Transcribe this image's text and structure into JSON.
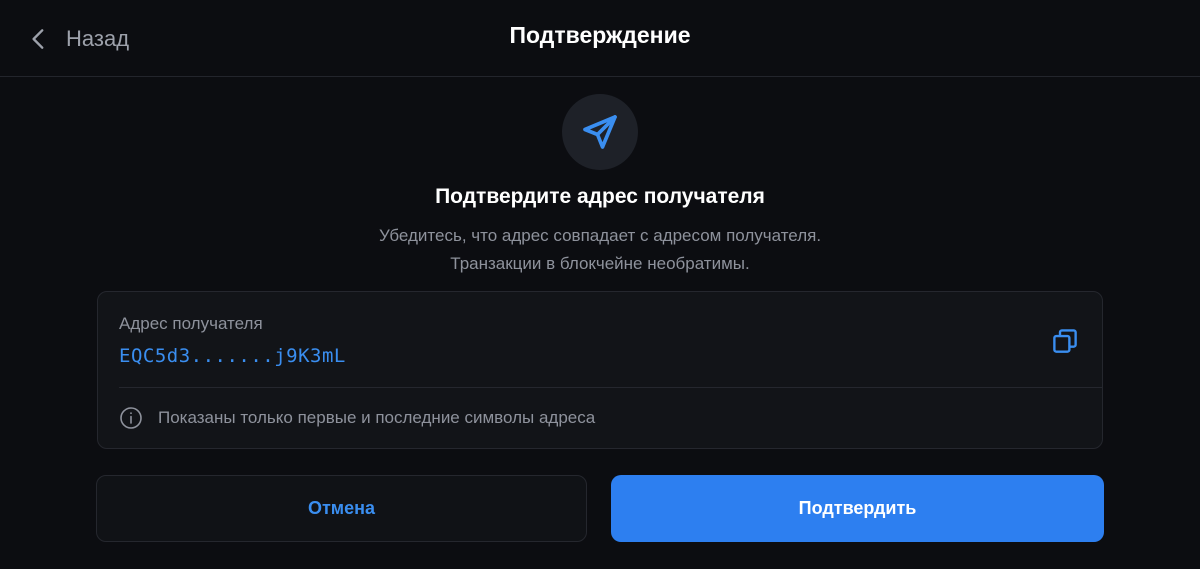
{
  "header": {
    "back_label": "Назад",
    "title": "Подтверждение"
  },
  "main": {
    "icon": "send-icon",
    "heading": "Подтвердите адрес получателя",
    "subtitle_line1": "Убедитесь, что адрес совпадает с адресом получателя.",
    "subtitle_line2": "Транзакции в блокчейне необратимы."
  },
  "card": {
    "label": "Адрес получателя",
    "address": "EQC5d3.......j9K3mL",
    "note": "Показаны только первые и последние символы адреса"
  },
  "actions": {
    "cancel_label": "Отмена",
    "confirm_label": "Подтвердить"
  },
  "colors": {
    "background": "#0c0d11",
    "accent": "#2d7ff0",
    "address": "#3a8ef0",
    "muted_text": "#8e929c"
  }
}
